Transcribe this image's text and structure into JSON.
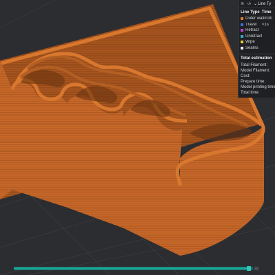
{
  "toolbar": {
    "view_icon": "layers-icon",
    "code_icon": "code-brackets-icon",
    "dropdown_icon": "chevron-down-icon",
    "view_select_value": "Line Ty"
  },
  "legend": {
    "col_type": "Line Type",
    "col_time": "Time",
    "rows": [
      {
        "label": "Outer wall",
        "value": "3m30",
        "color": "#e07a30"
      },
      {
        "label": "Travel",
        "value": "<1s",
        "color": "#3a6fe0"
      },
      {
        "label": "Retract",
        "value": "",
        "color": "#c542d6"
      },
      {
        "label": "Unretract",
        "value": "",
        "color": "#3fa3c8"
      },
      {
        "label": "Wipe",
        "value": "",
        "color": "#e8d430"
      },
      {
        "label": "Seams",
        "value": "",
        "color": "#ededed"
      }
    ]
  },
  "estimation": {
    "title": "Total estimation",
    "items": [
      {
        "label": "Total Filament:"
      },
      {
        "label": "Model Filament:"
      },
      {
        "label": "Cost:"
      },
      {
        "label": "Prepare time:"
      },
      {
        "label": "Model printing time:"
      },
      {
        "label": "Total time:"
      }
    ]
  },
  "layer_slider": {
    "position": 0.99
  },
  "colors": {
    "model": "#c46a22",
    "background": "#2c2d31",
    "slider": "#18a99b"
  }
}
